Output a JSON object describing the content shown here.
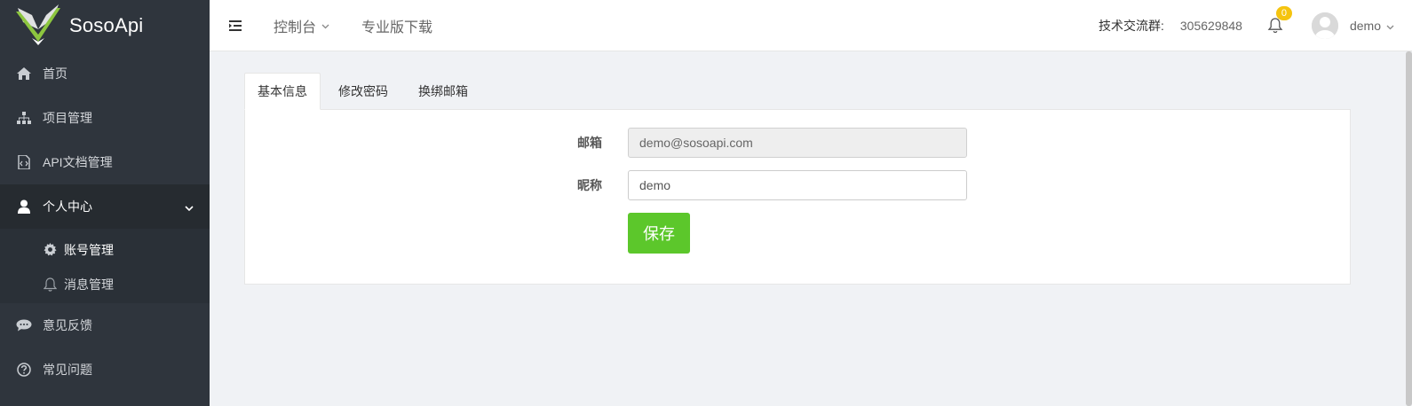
{
  "brand": {
    "name": "SosoApi",
    "logo_icon": "sosoapi-logo-icon"
  },
  "sidebar": {
    "items": [
      {
        "label": "首页",
        "icon": "home-icon"
      },
      {
        "label": "项目管理",
        "icon": "sitemap-icon"
      },
      {
        "label": "API文档管理",
        "icon": "code-file-icon"
      },
      {
        "label": "个人中心",
        "icon": "user-icon",
        "expanded": true
      },
      {
        "label": "意见反馈",
        "icon": "comments-icon"
      },
      {
        "label": "常见问题",
        "icon": "question-circle-icon"
      }
    ],
    "sub_items": [
      {
        "label": "账号管理",
        "icon": "gear-icon",
        "active": true
      },
      {
        "label": "消息管理",
        "icon": "bell-icon"
      }
    ]
  },
  "header": {
    "nav": [
      {
        "label": "控制台",
        "has_dropdown": true
      },
      {
        "label": "专业版下载"
      }
    ],
    "qq_group_label": "技术交流群:",
    "qq_group_number": "305629848",
    "notification_count": "0",
    "username": "demo"
  },
  "tabs": [
    {
      "label": "基本信息",
      "active": true
    },
    {
      "label": "修改密码"
    },
    {
      "label": "换绑邮箱"
    }
  ],
  "form": {
    "email_label": "邮箱",
    "email_value": "demo@sosoapi.com",
    "nickname_label": "昵称",
    "nickname_value": "demo",
    "save_label": "保存"
  },
  "colors": {
    "sidebar_bg": "#2f353d",
    "sidebar_active_bg": "#262b30",
    "save_button": "#5cc72b",
    "badge": "#f5c40f",
    "logo_green": "#8dc63f"
  }
}
